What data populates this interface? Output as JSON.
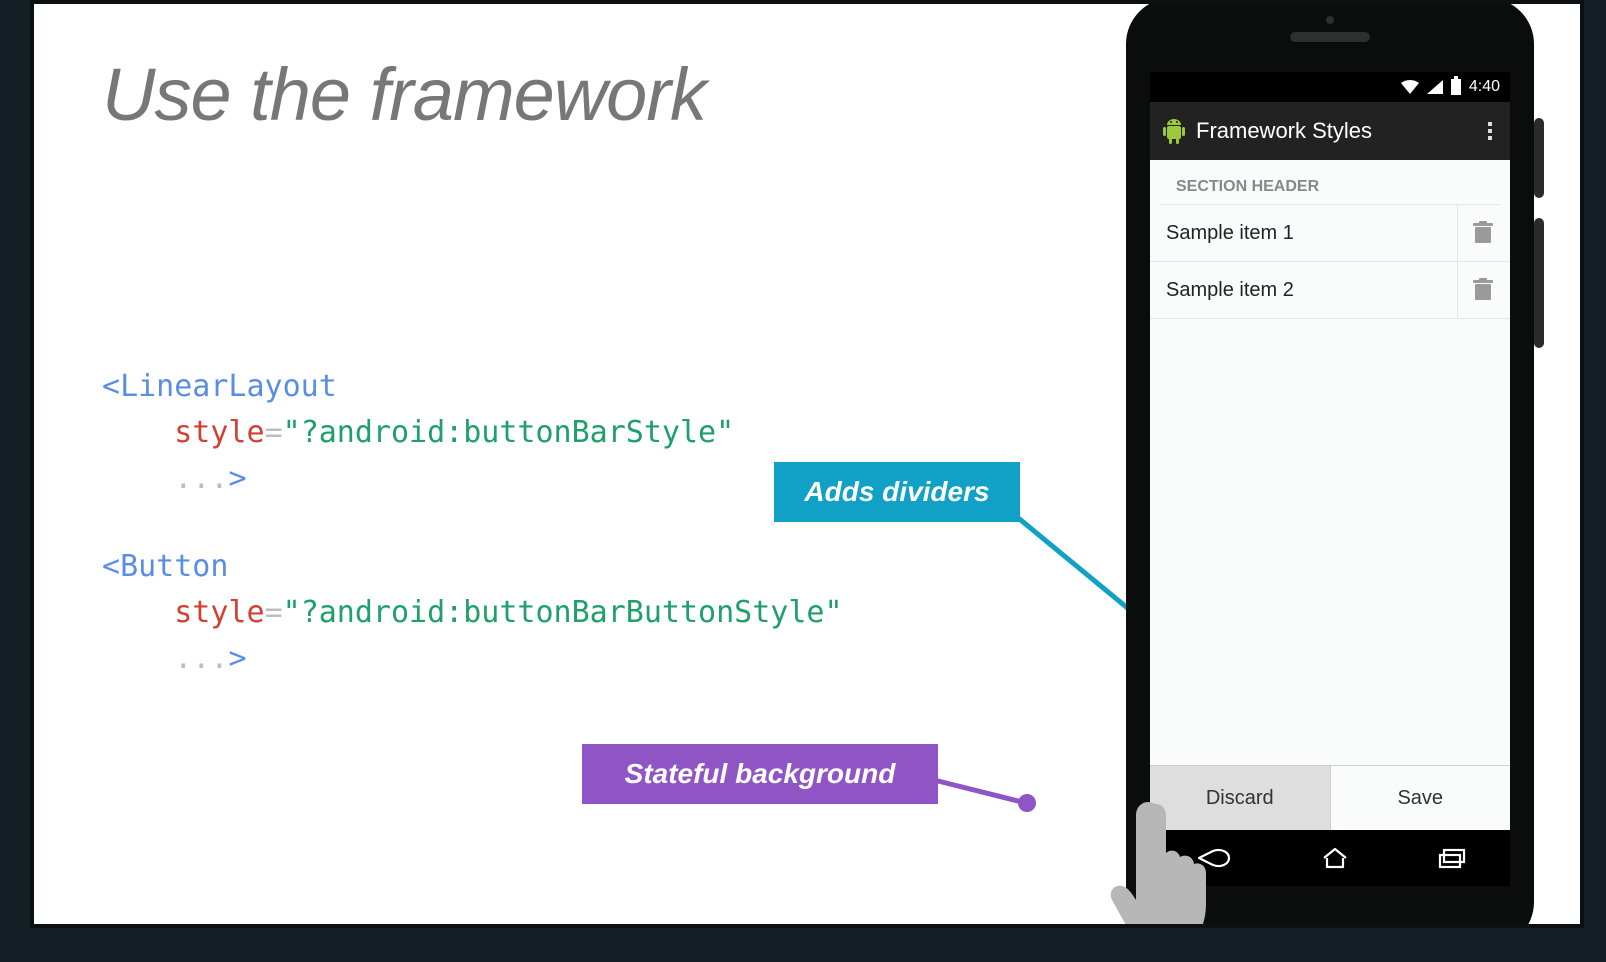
{
  "title": "Use the framework",
  "code1": {
    "l1_open": "<",
    "l1_tag": "LinearLayout",
    "l2_attr": "style",
    "l2_eq": "=",
    "l2_q1": "\"",
    "l2_val": "?android:buttonBarStyle",
    "l2_q2": "\"",
    "l3_dots": "...",
    "l3_close": ">"
  },
  "code2": {
    "l1_open": "<",
    "l1_tag": "Button",
    "l2_attr": "style",
    "l2_eq": "=",
    "l2_q1": "\"",
    "l2_val": "?android:buttonBarButtonStyle",
    "l2_q2": "\"",
    "l3_dots": "...",
    "l3_close": ">"
  },
  "callouts": {
    "dividers": "Adds dividers",
    "stateful": "Stateful background"
  },
  "phone": {
    "status_time": "4:40",
    "app_title": "Framework Styles",
    "section_header": "SECTION HEADER",
    "item1": "Sample item 1",
    "item2": "Sample item 2",
    "discard": "Discard",
    "save": "Save"
  }
}
